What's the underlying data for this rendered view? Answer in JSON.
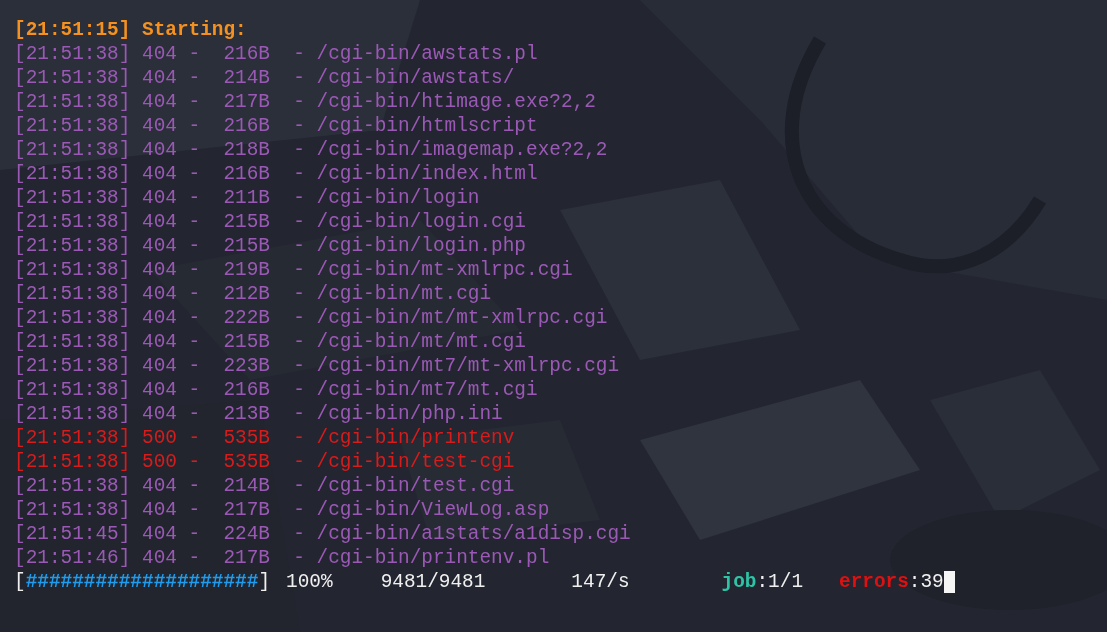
{
  "header": "[21:51:15] Starting:",
  "lines": [
    {
      "text": "[21:51:38] 404 -  216B  - /cgi-bin/awstats.pl",
      "color": "#9b59b6"
    },
    {
      "text": "[21:51:38] 404 -  214B  - /cgi-bin/awstats/",
      "color": "#9b59b6"
    },
    {
      "text": "[21:51:38] 404 -  217B  - /cgi-bin/htimage.exe?2,2",
      "color": "#9b59b6"
    },
    {
      "text": "[21:51:38] 404 -  216B  - /cgi-bin/htmlscript",
      "color": "#9b59b6"
    },
    {
      "text": "[21:51:38] 404 -  218B  - /cgi-bin/imagemap.exe?2,2",
      "color": "#9b59b6"
    },
    {
      "text": "[21:51:38] 404 -  216B  - /cgi-bin/index.html",
      "color": "#9b59b6"
    },
    {
      "text": "[21:51:38] 404 -  211B  - /cgi-bin/login",
      "color": "#9b59b6"
    },
    {
      "text": "[21:51:38] 404 -  215B  - /cgi-bin/login.cgi",
      "color": "#9b59b6"
    },
    {
      "text": "[21:51:38] 404 -  215B  - /cgi-bin/login.php",
      "color": "#9b59b6"
    },
    {
      "text": "[21:51:38] 404 -  219B  - /cgi-bin/mt-xmlrpc.cgi",
      "color": "#9b59b6"
    },
    {
      "text": "[21:51:38] 404 -  212B  - /cgi-bin/mt.cgi",
      "color": "#9b59b6"
    },
    {
      "text": "[21:51:38] 404 -  222B  - /cgi-bin/mt/mt-xmlrpc.cgi",
      "color": "#9b59b6"
    },
    {
      "text": "[21:51:38] 404 -  215B  - /cgi-bin/mt/mt.cgi",
      "color": "#9b59b6"
    },
    {
      "text": "[21:51:38] 404 -  223B  - /cgi-bin/mt7/mt-xmlrpc.cgi",
      "color": "#9b59b6"
    },
    {
      "text": "[21:51:38] 404 -  216B  - /cgi-bin/mt7/mt.cgi",
      "color": "#9b59b6"
    },
    {
      "text": "[21:51:38] 404 -  213B  - /cgi-bin/php.ini",
      "color": "#9b59b6"
    },
    {
      "text": "[21:51:38] 500 -  535B  - /cgi-bin/printenv",
      "color": "#d81b1b"
    },
    {
      "text": "[21:51:38] 500 -  535B  - /cgi-bin/test-cgi",
      "color": "#d81b1b"
    },
    {
      "text": "[21:51:38] 404 -  214B  - /cgi-bin/test.cgi",
      "color": "#9b59b6"
    },
    {
      "text": "[21:51:38] 404 -  217B  - /cgi-bin/ViewLog.asp",
      "color": "#9b59b6"
    },
    {
      "text": "[21:51:45] 404 -  224B  - /cgi-bin/a1stats/a1disp.cgi",
      "color": "#9b59b6"
    },
    {
      "text": "[21:51:46] 404 -  217B  - /cgi-bin/printenv.pl",
      "color": "#9b59b6"
    }
  ],
  "progress": {
    "open": "[",
    "bar": "####################",
    "close": "]",
    "percent": "100%",
    "count": "9481/9481",
    "rate": "147/s",
    "job_label": "job",
    "job_value": ":1/1",
    "errors_label": "errors",
    "errors_value": ":39"
  }
}
